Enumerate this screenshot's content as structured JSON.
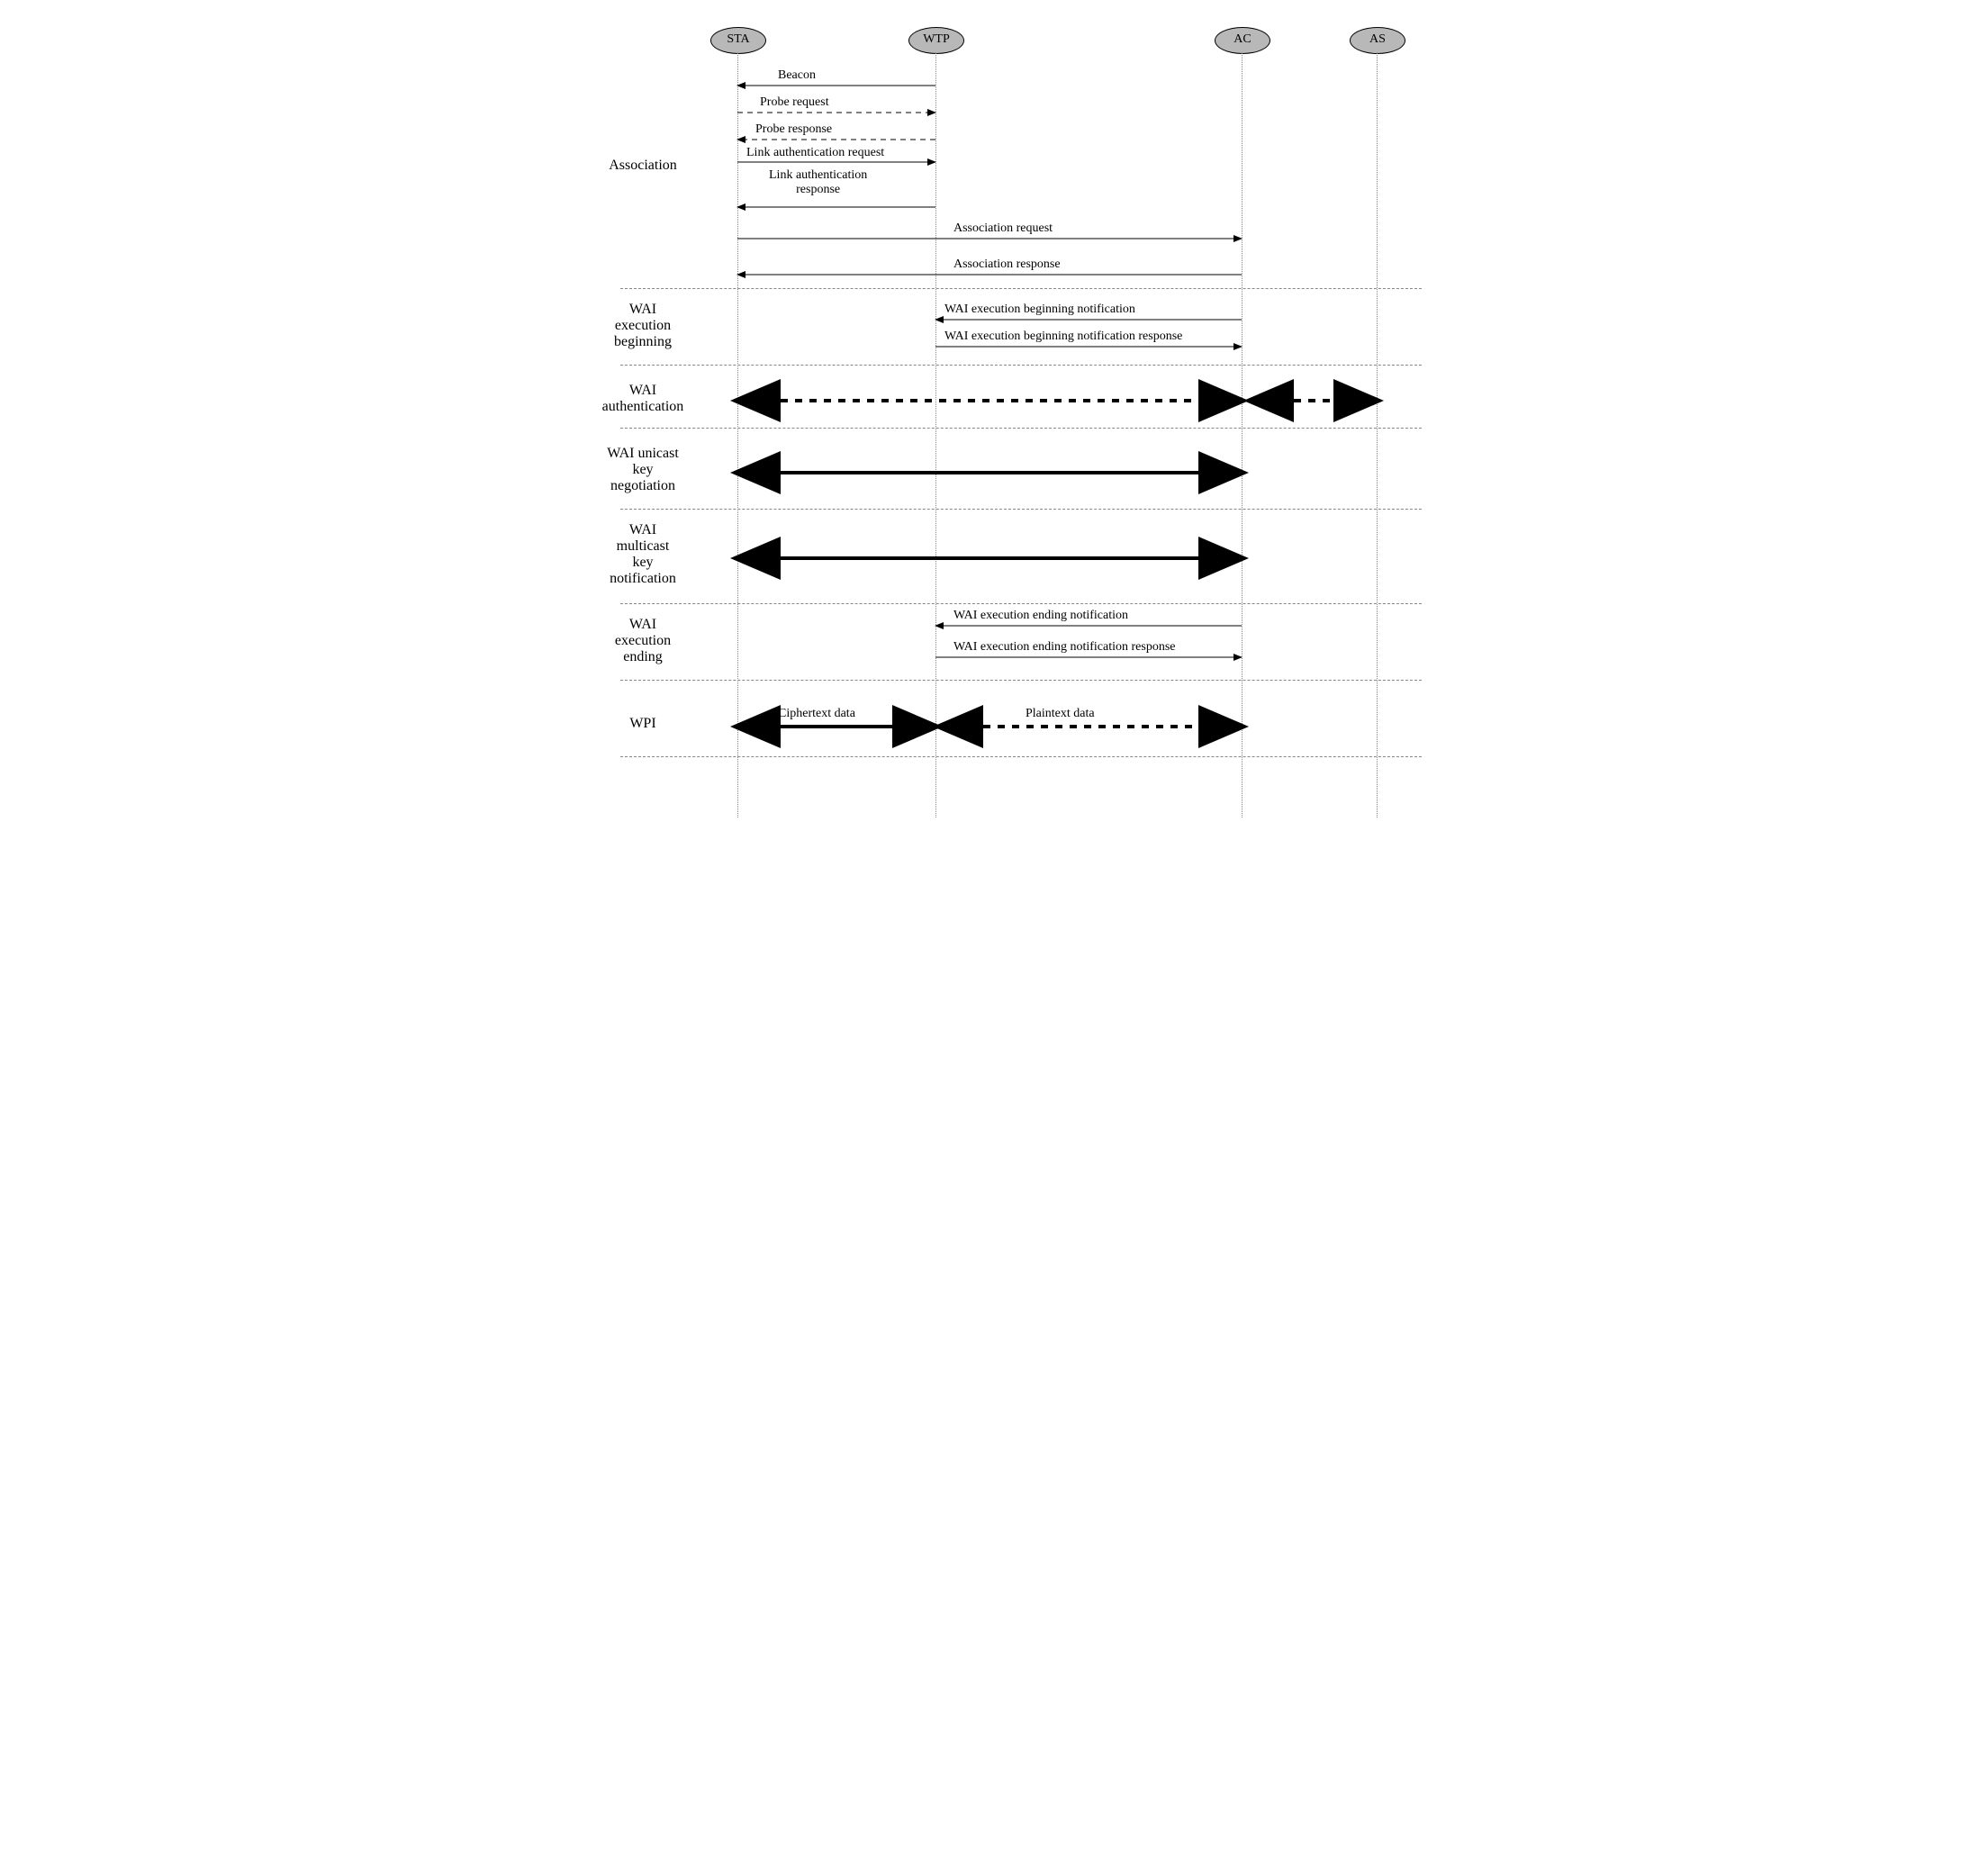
{
  "actors": {
    "sta": "STA",
    "wtp": "WTP",
    "ac": "AC",
    "as": "AS"
  },
  "phases": {
    "association": "Association",
    "wai_exec_begin": "WAI\nexecution\nbeginning",
    "wai_auth": "WAI\nauthentication",
    "wai_unicast": "WAI unicast\nkey\nnegotiation",
    "wai_multicast": "WAI\nmulticast\nkey\nnotification",
    "wai_exec_end": "WAI\nexecution\nending",
    "wpi": "WPI"
  },
  "messages": {
    "beacon": "Beacon",
    "probe_req": "Probe request",
    "probe_resp": "Probe response",
    "link_auth_req": "Link authentication request",
    "link_auth_resp": "Link authentication\nresponse",
    "assoc_req": "Association request",
    "assoc_resp": "Association response",
    "wai_begin_notif": "WAI execution beginning notification",
    "wai_begin_notif_resp": "WAI execution beginning notification response",
    "wai_end_notif": "WAI execution ending notification",
    "wai_end_notif_resp": "WAI execution ending notification response",
    "ciphertext": "Ciphertext data",
    "plaintext": "Plaintext data"
  },
  "chart_data": {
    "type": "sequence-diagram",
    "actors": [
      "STA",
      "WTP",
      "AC",
      "AS"
    ],
    "phases": [
      {
        "name": "Association",
        "messages": [
          {
            "from": "WTP",
            "to": "STA",
            "label": "Beacon",
            "style": "solid"
          },
          {
            "from": "STA",
            "to": "WTP",
            "label": "Probe request",
            "style": "dashed"
          },
          {
            "from": "WTP",
            "to": "STA",
            "label": "Probe response",
            "style": "dashed"
          },
          {
            "from": "STA",
            "to": "WTP",
            "label": "Link authentication request",
            "style": "solid"
          },
          {
            "from": "WTP",
            "to": "STA",
            "label": "Link authentication response",
            "style": "solid"
          },
          {
            "from": "STA",
            "to": "AC",
            "label": "Association request",
            "style": "solid"
          },
          {
            "from": "AC",
            "to": "STA",
            "label": "Association response",
            "style": "solid"
          }
        ]
      },
      {
        "name": "WAI execution beginning",
        "messages": [
          {
            "from": "AC",
            "to": "WTP",
            "label": "WAI execution beginning notification",
            "style": "solid"
          },
          {
            "from": "WTP",
            "to": "AC",
            "label": "WAI execution beginning notification response",
            "style": "solid"
          }
        ]
      },
      {
        "name": "WAI authentication",
        "messages": [
          {
            "between": [
              "STA",
              "AC"
            ],
            "style": "bold-dashed-bidir"
          },
          {
            "between": [
              "AC",
              "AS"
            ],
            "style": "bold-dashed-bidir"
          }
        ]
      },
      {
        "name": "WAI unicast key negotiation",
        "messages": [
          {
            "between": [
              "STA",
              "AC"
            ],
            "style": "bold-solid-bidir"
          }
        ]
      },
      {
        "name": "WAI multicast key notification",
        "messages": [
          {
            "between": [
              "STA",
              "AC"
            ],
            "style": "bold-solid-bidir"
          }
        ]
      },
      {
        "name": "WAI execution ending",
        "messages": [
          {
            "from": "AC",
            "to": "WTP",
            "label": "WAI execution ending notification",
            "style": "solid"
          },
          {
            "from": "WTP",
            "to": "AC",
            "label": "WAI execution ending notification response",
            "style": "solid"
          }
        ]
      },
      {
        "name": "WPI",
        "messages": [
          {
            "between": [
              "STA",
              "WTP"
            ],
            "label": "Ciphertext data",
            "style": "bold-solid-bidir"
          },
          {
            "between": [
              "WTP",
              "AC"
            ],
            "label": "Plaintext data",
            "style": "bold-dashed-bidir"
          }
        ]
      }
    ]
  }
}
